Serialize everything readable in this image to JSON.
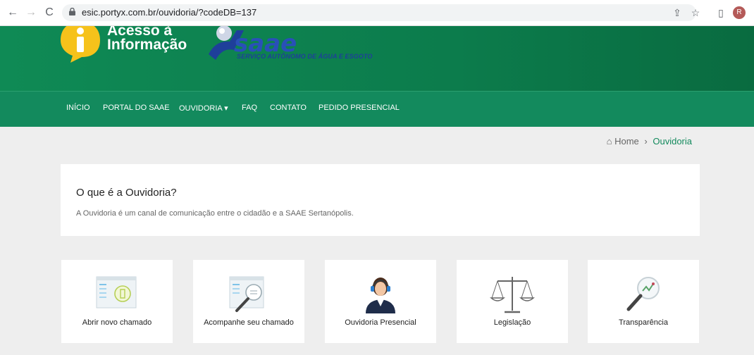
{
  "browser": {
    "url": "esic.portyx.com.br/ouvidoria/?codeDB=137",
    "avatar_letter": "R"
  },
  "header": {
    "acesso_line1": "Acesso à",
    "acesso_line2": "Informação",
    "logo_text": "saae",
    "logo_subtitle": "SERVIÇO AUTÔNOMO DE ÁGUA E ESGOTO"
  },
  "menu": {
    "items": [
      "INÍCIO",
      "PORTAL DO SAAE",
      "OUVIDORIA ▾",
      "FAQ",
      "CONTATO",
      "PEDIDO PRESENCIAL"
    ]
  },
  "breadcrumb": {
    "home": "Home",
    "separator": "›",
    "current": "Ouvidoria"
  },
  "intro": {
    "title": "O que é a Ouvidoria?",
    "text": "A Ouvidoria é um canal de comunicação entre o cidadão e a SAAE Sertanópolis."
  },
  "cards": [
    {
      "label": "Abrir novo chamado",
      "icon": "new-ticket-icon"
    },
    {
      "label": "Acompanhe seu chamado",
      "icon": "track-ticket-icon"
    },
    {
      "label": "Ouvidoria Presencial",
      "icon": "attendant-icon"
    },
    {
      "label": "Legislação",
      "icon": "scales-icon"
    },
    {
      "label": "Transparência",
      "icon": "magnifier-chart-icon"
    }
  ],
  "colors": {
    "header_green": "#0f8a55",
    "menu_green": "#138a5d",
    "logo_blue": "#1e3f9a",
    "badge_yellow": "#f6c21b"
  }
}
